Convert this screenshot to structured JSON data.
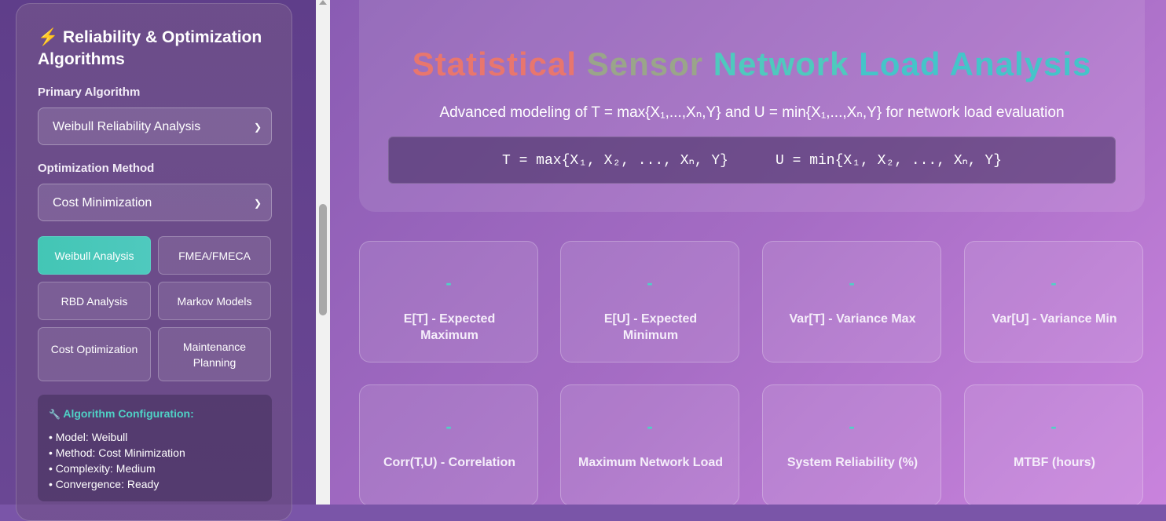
{
  "sidebar": {
    "title_icon": "⚡",
    "title": "Reliability & Optimization Algorithms",
    "primary_algorithm_label": "Primary Algorithm",
    "primary_algorithm_value": "Weibull Reliability Analysis",
    "optimization_method_label": "Optimization Method",
    "optimization_method_value": "Cost Minimization",
    "buttons": [
      {
        "label": "Weibull Analysis",
        "active": true
      },
      {
        "label": "FMEA/FMECA",
        "active": false
      },
      {
        "label": "RBD Analysis",
        "active": false
      },
      {
        "label": "Markov Models",
        "active": false
      },
      {
        "label": "Cost Optimization",
        "active": false
      },
      {
        "label": "Maintenance Planning",
        "active": false
      }
    ],
    "config": {
      "icon": "🔧",
      "title": "Algorithm Configuration:",
      "lines": [
        "• Model: Weibull",
        "• Method: Cost Minimization",
        "• Complexity: Medium",
        "• Convergence: Ready"
      ]
    }
  },
  "header": {
    "title_parts": [
      "Statistical",
      "Sensor",
      "Network",
      "Load",
      "Analysis"
    ],
    "subtitle": "Advanced modeling of T = max{X₁,...,Xₙ,Y} and U = min{X₁,...,Xₙ,Y} for network load evaluation",
    "formula_max": "T = max{X₁, X₂, ..., Xₙ, Y}",
    "formula_min": "U = min{X₁, X₂, ..., Xₙ, Y}"
  },
  "metrics": [
    {
      "value": "-",
      "label": "E[T] - Expected Maximum"
    },
    {
      "value": "-",
      "label": "E[U] - Expected Minimum"
    },
    {
      "value": "-",
      "label": "Var[T] - Variance Max"
    },
    {
      "value": "-",
      "label": "Var[U] - Variance Min"
    },
    {
      "value": "-",
      "label": "Corr(T,U) - Correlation"
    },
    {
      "value": "-",
      "label": "Maximum Network Load"
    },
    {
      "value": "-",
      "label": "System Reliability (%)"
    },
    {
      "value": "-",
      "label": "MTBF (hours)"
    }
  ],
  "colors": {
    "accent": "#4fd1c5",
    "active_button": "#43c6b5"
  }
}
